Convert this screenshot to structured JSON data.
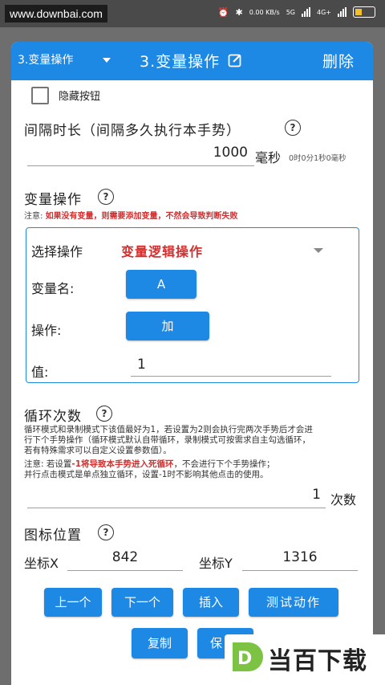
{
  "statusbar": {
    "site": "www.downbai.com",
    "net_speed": "0.00 KB/s",
    "network_5g": "5G",
    "network_4g": "4G+"
  },
  "dialog": {
    "header": {
      "select_value": "3.变量操作",
      "title": "3.变量操作",
      "delete_label": "删除"
    },
    "hide_button_label": "隐藏按钮",
    "interval": {
      "title": "间隔时长（间隔多久执行本手势）",
      "help": "?",
      "value": "1000",
      "unit": "毫秒",
      "breakdown": "0时0分1秒0毫秒"
    },
    "variable_op": {
      "title": "变量操作",
      "help": "?",
      "note_prefix": "注意:",
      "note_text": "如果没有变量，则需要添加变量，不然会导致判断失败",
      "select_label": "选择操作",
      "select_value": "变量逻辑操作",
      "var_name_label": "变量名:",
      "var_name_value": "A",
      "operation_label": "操作:",
      "operation_value": "加",
      "value_label": "值:",
      "value_value": "1"
    },
    "loop": {
      "title": "循环次数",
      "help": "?",
      "desc_line1": "循环模式和录制模式下该值最好为1，若设置为2则会执行完两次手势后才会进",
      "desc_line2": "行下个手势操作（循环模式默认自带循环，录制模式可按需求自主勾选循环，",
      "desc_line3": "若有特殊需求可以自定义设置参数值）。",
      "note_prefix": "注意:  若设置",
      "note_red": "-1将导致本手势进入死循环",
      "note_suffix": "，不会进行下个手势操作；",
      "note_line2": "并行点击模式是单点独立循环，设置-1时不影响其他点击的使用。",
      "value": "1",
      "unit": "次数"
    },
    "icon_position": {
      "title": "图标位置",
      "help": "?",
      "x_label": "坐标X",
      "x_value": "842",
      "y_label": "坐标Y",
      "y_value": "1316"
    },
    "buttons": {
      "prev": "上一个",
      "next": "下一个",
      "insert": "插入",
      "test": "测试动作",
      "copy": "复制",
      "save": "保"
    }
  },
  "watermark": {
    "text": "当百下载",
    "logo_letter": "D"
  },
  "colors": {
    "accent": "#1e88e5",
    "warning": "#d32f2f"
  }
}
